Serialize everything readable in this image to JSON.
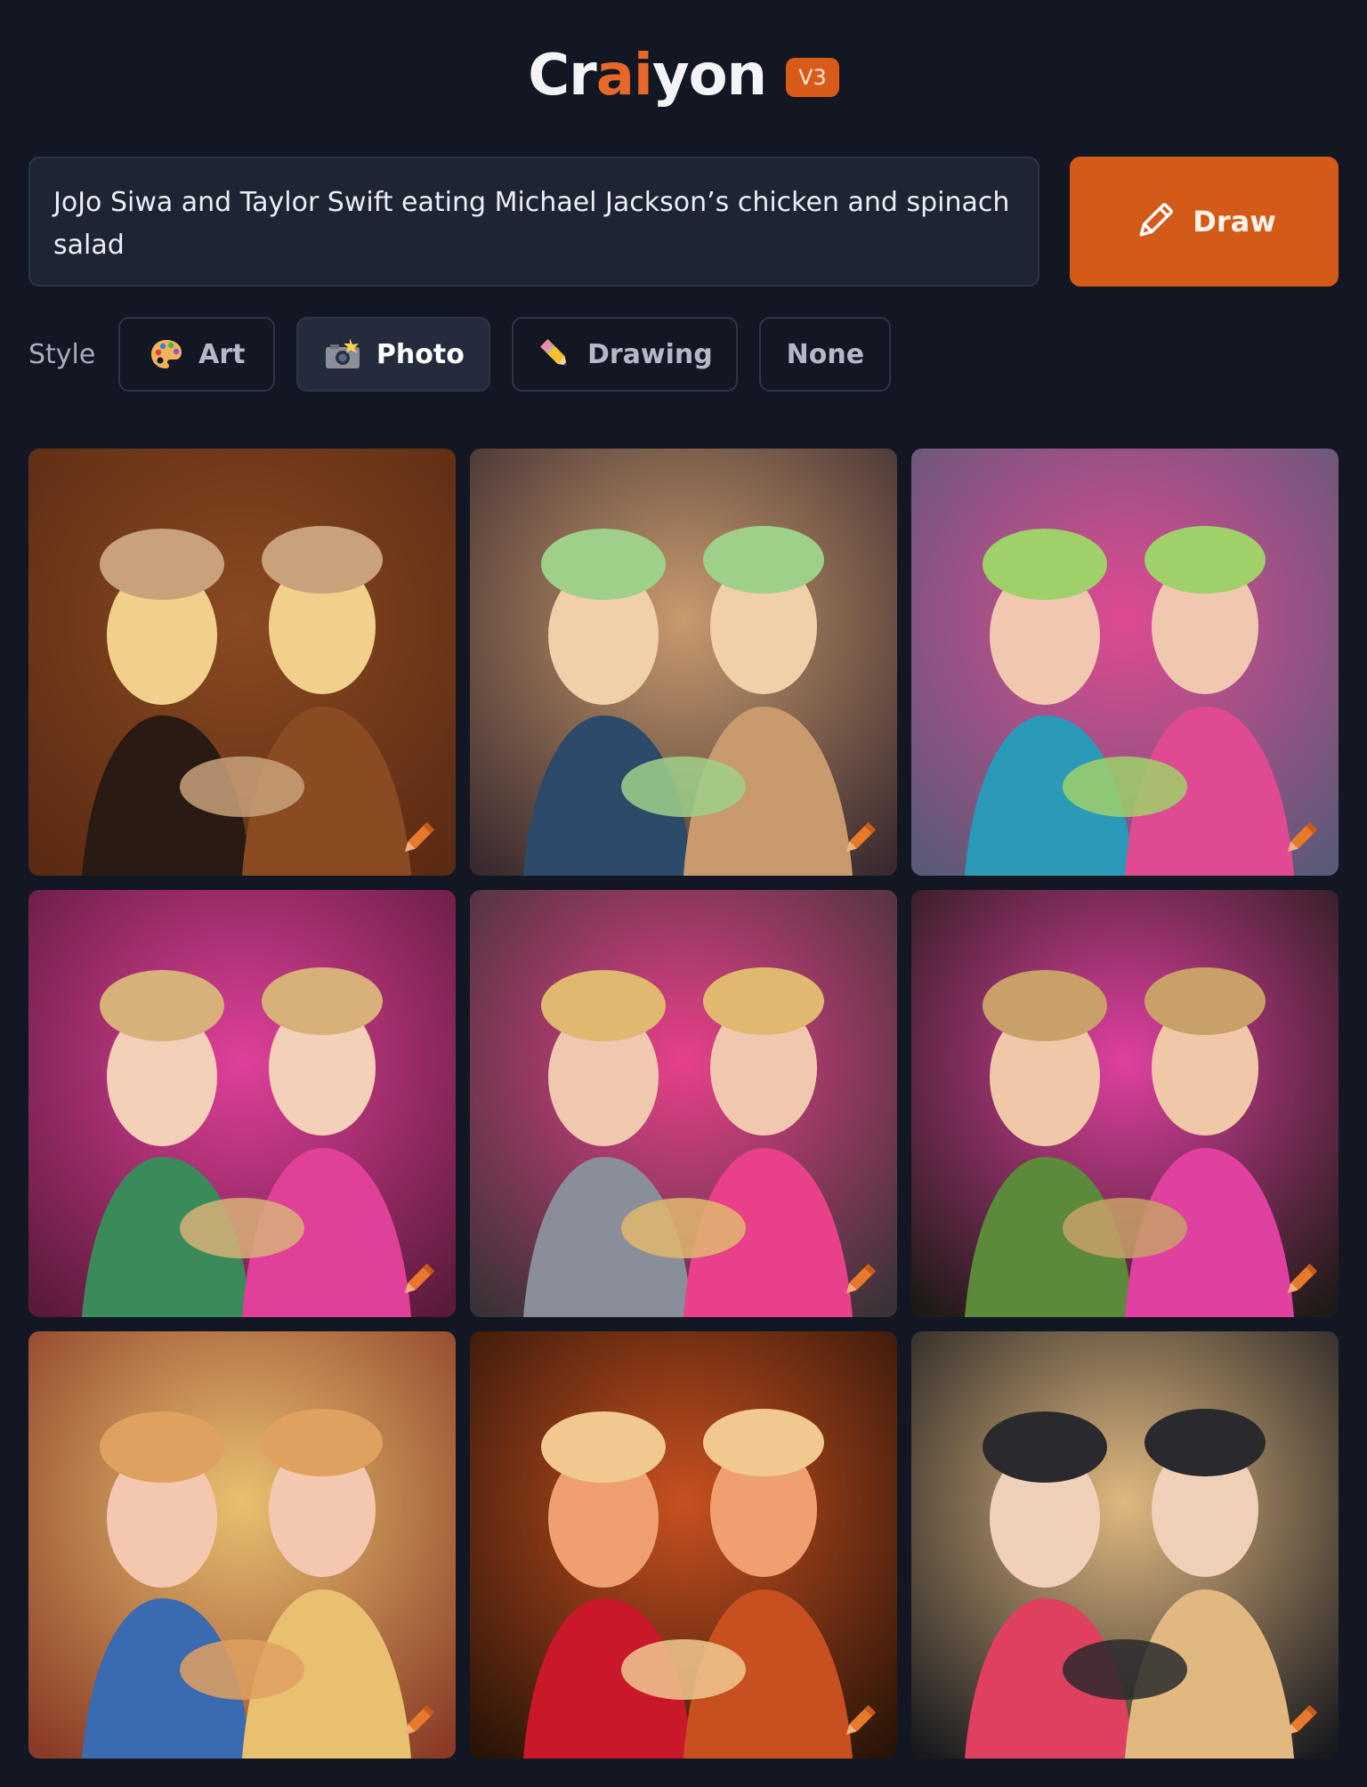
{
  "header": {
    "logo_part1": "Cr",
    "logo_part2": "ai",
    "logo_part3": "yon",
    "version_badge": "V3"
  },
  "prompt": {
    "value": "JoJo Siwa and Taylor Swift eating Michael Jackson’s chicken and spinach salad"
  },
  "draw_button": {
    "label": "Draw",
    "icon": "pencil-icon"
  },
  "style": {
    "label": "Style",
    "options": [
      {
        "label": "Art",
        "icon": "palette-icon",
        "selected": false
      },
      {
        "label": "Photo",
        "icon": "camera-flash-icon",
        "selected": true
      },
      {
        "label": "Drawing",
        "icon": "pencil-emoji-icon",
        "selected": false
      },
      {
        "label": "None",
        "icon": "",
        "selected": false
      }
    ]
  },
  "gallery": {
    "images": [
      {
        "description_icon": "generated-image",
        "edit_icon": "pencil-icon"
      },
      {
        "description_icon": "generated-image",
        "edit_icon": "pencil-icon"
      },
      {
        "description_icon": "generated-image",
        "edit_icon": "pencil-icon"
      },
      {
        "description_icon": "generated-image",
        "edit_icon": "pencil-icon"
      },
      {
        "description_icon": "generated-image",
        "edit_icon": "pencil-icon"
      },
      {
        "description_icon": "generated-image",
        "edit_icon": "pencil-icon"
      },
      {
        "description_icon": "generated-image",
        "edit_icon": "pencil-icon"
      },
      {
        "description_icon": "generated-image",
        "edit_icon": "pencil-icon"
      },
      {
        "description_icon": "generated-image",
        "edit_icon": "pencil-icon"
      }
    ]
  },
  "colors": {
    "background": "#121723",
    "accent": "#d35a17",
    "logo_ai": "#e8682b",
    "input_bg": "#1d2434"
  }
}
